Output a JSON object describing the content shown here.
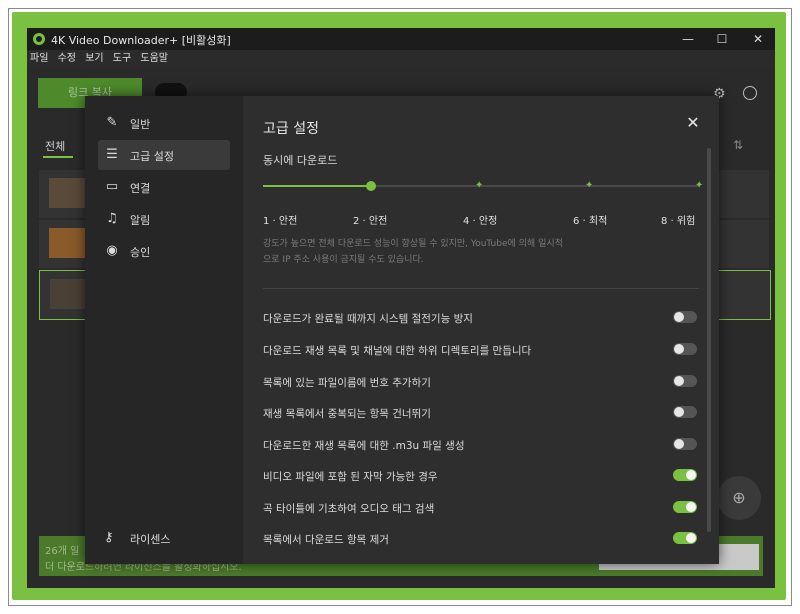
{
  "window": {
    "title": "4K Video Downloader+ [비활성화]"
  },
  "menu": [
    "파일",
    "수정",
    "보기",
    "도구",
    "도움말"
  ],
  "background": {
    "paste_link": "링크 복사",
    "tab_all": "전체",
    "bottom_line1": "26개 일",
    "bottom_line2": "더 다운로드하려면 라이선스를 활성화하십시오."
  },
  "sidebar": {
    "items": [
      {
        "label": "일반",
        "icon": "wrench-icon"
      },
      {
        "label": "고급 설정",
        "icon": "sliders-icon"
      },
      {
        "label": "연결",
        "icon": "server-icon"
      },
      {
        "label": "알림",
        "icon": "bell-icon"
      },
      {
        "label": "승인",
        "icon": "user-circle-icon"
      }
    ],
    "license": {
      "label": "라이센스",
      "icon": "key-icon"
    }
  },
  "settings": {
    "heading": "고급 설정",
    "concurrent_label": "동시에 다운로드",
    "slider_value": 2,
    "steps": [
      "1 · 안전",
      "2 · 안전",
      "4 · 안정",
      "6 · 최적",
      "8 · 위험"
    ],
    "note": "강도가 높으면 전체 다운로드 성능이 향상될 수 있지만, YouTube에 의해 일시적으로 IP 주소 사용이 금지될 수도 있습니다.",
    "options": [
      {
        "label": "다운로드가 완료될 때까지 시스템 절전기능 방지",
        "on": false
      },
      {
        "label": "다운로드 재생 목록 및 채널에 대한 하위 디렉토리를 만듭니다",
        "on": false
      },
      {
        "label": "목록에 있는 파일이름에 번호 추가하기",
        "on": false
      },
      {
        "label": "재생 목록에서 중복되는 항목 건너뛰기",
        "on": false
      },
      {
        "label": "다운로드한 재생 목록에 대한 .m3u 파일 생성",
        "on": false
      },
      {
        "label": "비디오 파일에 포함 된 자막 가능한 경우",
        "on": true
      },
      {
        "label": "곡 타이틀에 기초하여 오디오 태그 검색",
        "on": true
      },
      {
        "label": "목록에서 다운로드 항목 제거",
        "on": true
      }
    ]
  },
  "colors": {
    "accent": "#7ac142",
    "dialog_bg": "#2e2e2e",
    "sidebar_bg": "#262626"
  }
}
